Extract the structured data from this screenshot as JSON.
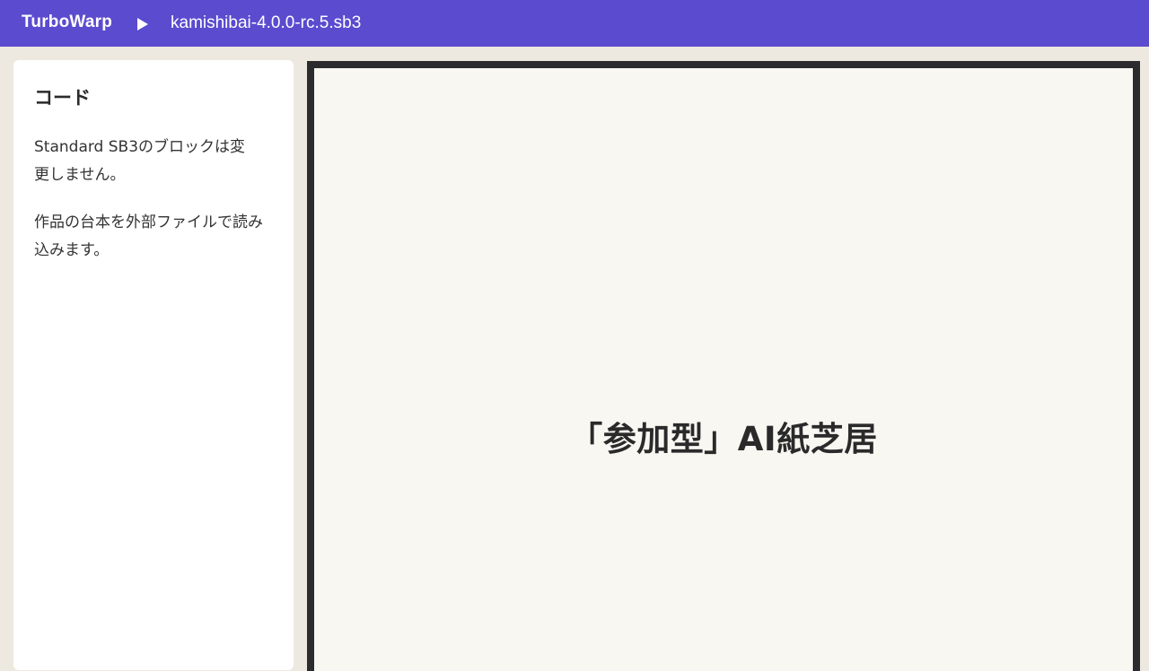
{
  "header": {
    "brand": "TurboWarp",
    "play_icon": "play-icon",
    "filename": "kamishibai-4.0.0-rc.5.sb3",
    "color": "#5a4bcf"
  },
  "sidebar": {
    "title": "コード",
    "paragraphs": [
      "Standard SB3のブロックは変更しません。",
      "作品の台本を外部ファイルで読み込みます。"
    ]
  },
  "stage": {
    "title": "「参加型」AI紙芝居"
  }
}
